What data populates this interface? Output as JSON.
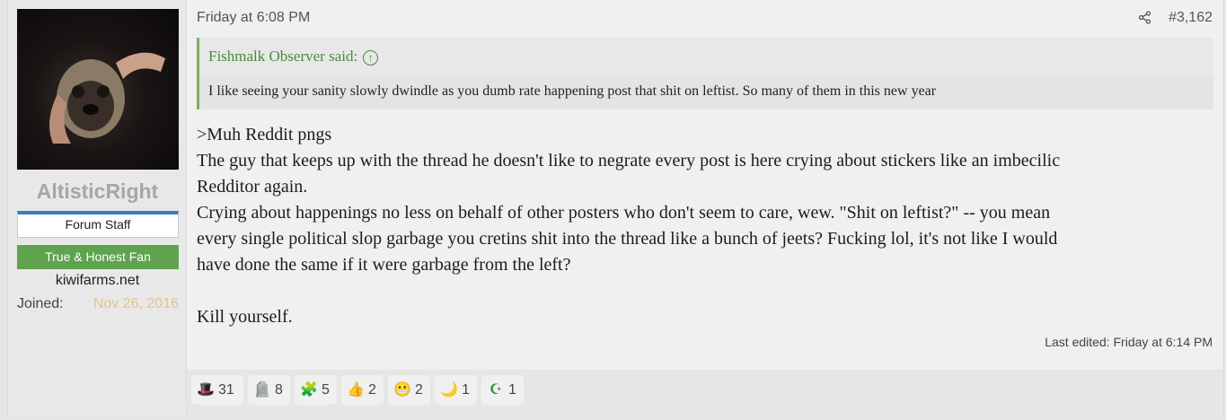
{
  "user": {
    "name": "AltisticRight",
    "banner_staff": "Forum Staff",
    "banner_fan": "True & Honest Fan",
    "site": "kiwifarms.net",
    "joined_label": "Joined:",
    "joined_value": "Nov 26, 2016"
  },
  "post": {
    "date": "Friday at 6:08 PM",
    "number": "#3,162",
    "quote_author": "Fishmalk Observer said:",
    "quote_text": "I like seeing your sanity slowly dwindle as you dumb rate happening post that shit on leftist. So many of them in this new year",
    "lines": [
      ">Muh Reddit pngs",
      "The guy that keeps up with the thread he doesn't like to negrate every post is here crying about stickers like an imbecilic",
      "Redditor again.",
      "Crying about happenings no less on behalf of other posters who don't seem to care, wew. \"Shit on leftist?\" -- you mean",
      "every single political slop garbage you cretins shit into the thread like a bunch of jeets? Fucking lol, it's not like I would",
      "have done the same if it were garbage from the left?",
      "Kill yourself."
    ],
    "edited": "Last edited: Friday at 6:14 PM"
  },
  "reactions": [
    {
      "icon": "top-hat-icon",
      "glyph": "🎩",
      "count": "31"
    },
    {
      "icon": "tombstone-icon",
      "glyph": "🪦",
      "count": "8"
    },
    {
      "icon": "puzzle-icon",
      "glyph": "🧩",
      "count": "5"
    },
    {
      "icon": "thumbs-up-icon",
      "glyph": "👍",
      "count": "2"
    },
    {
      "icon": "face-icon",
      "glyph": "😬",
      "count": "2"
    },
    {
      "icon": "moon-icon",
      "glyph": "🌙",
      "count": "1"
    },
    {
      "icon": "star-crescent-icon",
      "glyph": "☪",
      "count": "1"
    }
  ]
}
